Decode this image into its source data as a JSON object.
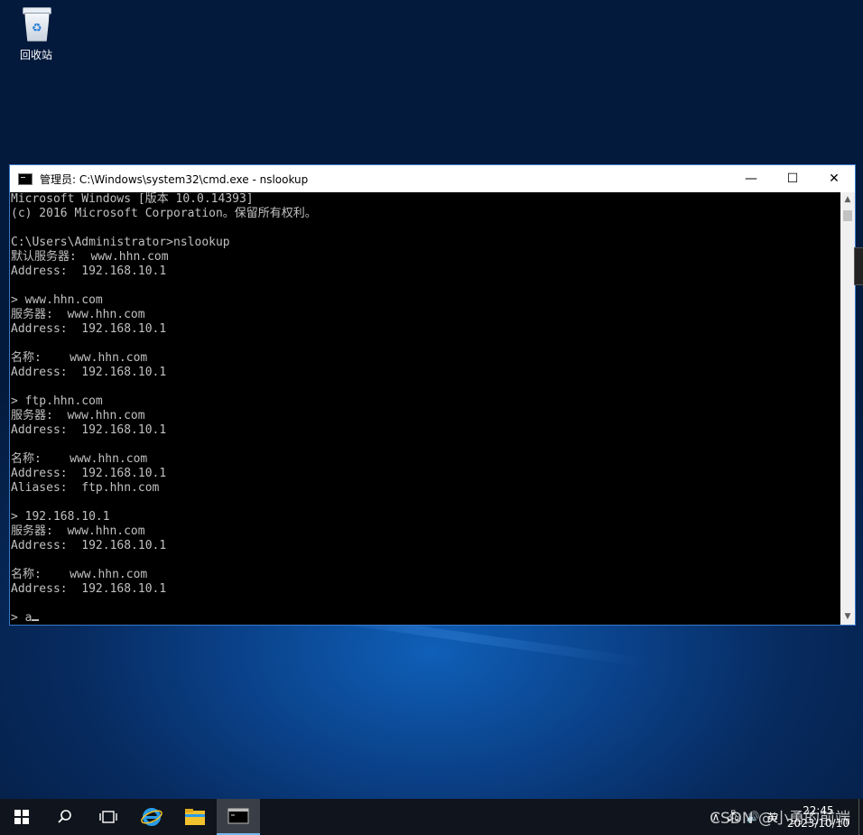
{
  "desktop": {
    "recycle_bin_label": "回收站"
  },
  "window": {
    "title": "管理员: C:\\Windows\\system32\\cmd.exe - nslookup",
    "minimize_glyph": "—",
    "maximize_glyph": "☐",
    "close_glyph": "✕",
    "console_lines": [
      "Microsoft Windows [版本 10.0.14393]",
      "(c) 2016 Microsoft Corporation。保留所有权利。",
      "",
      "C:\\Users\\Administrator>nslookup",
      "默认服务器:  www.hhn.com",
      "Address:  192.168.10.1",
      "",
      "> www.hhn.com",
      "服务器:  www.hhn.com",
      "Address:  192.168.10.1",
      "",
      "名称:    www.hhn.com",
      "Address:  192.168.10.1",
      "",
      "> ftp.hhn.com",
      "服务器:  www.hhn.com",
      "Address:  192.168.10.1",
      "",
      "名称:    www.hhn.com",
      "Address:  192.168.10.1",
      "Aliases:  ftp.hhn.com",
      "",
      "> 192.168.10.1",
      "服务器:  www.hhn.com",
      "Address:  192.168.10.1",
      "",
      "名称:    www.hhn.com",
      "Address:  192.168.10.1",
      "",
      "> a"
    ]
  },
  "taskbar": {
    "tray": {
      "ime": "英",
      "time": "22:45",
      "date": "2023/10/10"
    }
  },
  "watermark": "CSDN @小勇的前端",
  "colors": {
    "console_bg": "#000000",
    "console_fg": "#c0c0c0",
    "taskbar_bg": "#10141c",
    "accent": "#76b9ed"
  }
}
